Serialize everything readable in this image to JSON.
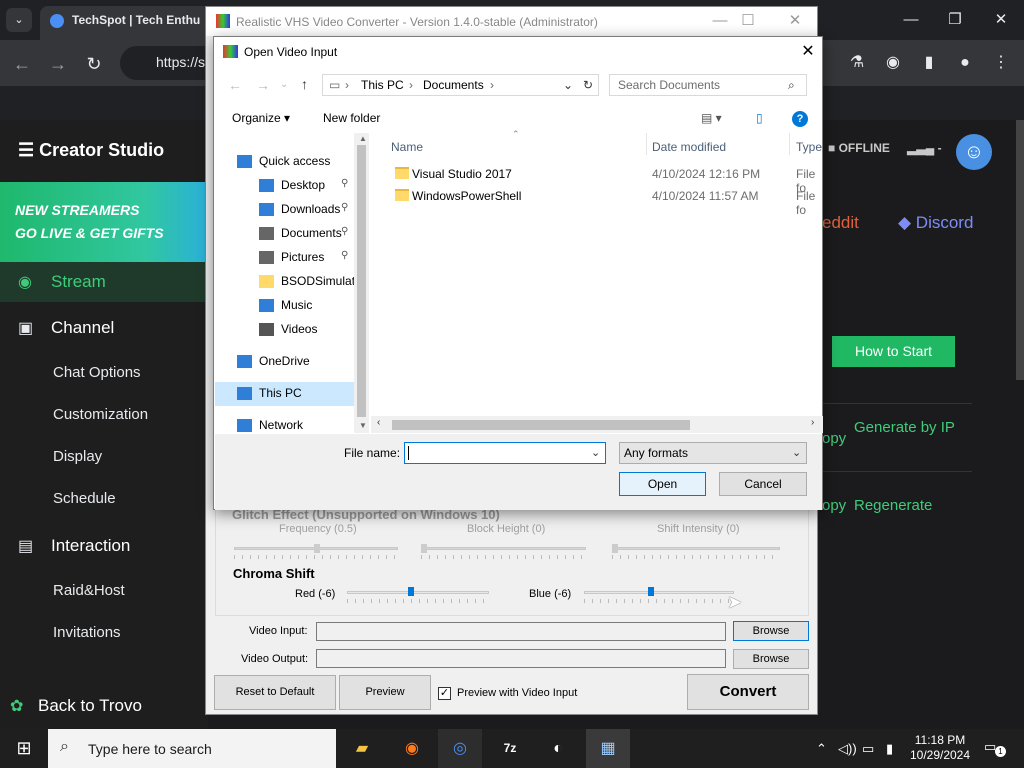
{
  "browser": {
    "tab_title": "TechSpot | Tech Enthu",
    "url": "https://s",
    "window_controls": [
      "—",
      "❐",
      "✕"
    ]
  },
  "studio": {
    "title": "Creator Studio",
    "banner_line1": "NEW STREAMERS",
    "banner_line2": "GO LIVE & GET GIFTS",
    "sidebar": {
      "stream": "Stream",
      "channel": "Channel",
      "chat_options": "Chat Options",
      "customization": "Customization",
      "display": "Display",
      "schedule": "Schedule",
      "interaction": "Interaction",
      "raid_host": "Raid&Host",
      "invitations": "Invitations",
      "back": "Back to Trovo"
    },
    "status": "OFFLINE",
    "status_dash": "-",
    "reddit": "eddit",
    "discord": "Discord",
    "how_to_start": "How to Start",
    "copy1": "opy",
    "generate_by_ip": "Generate by IP",
    "copy2": "opy",
    "regenerate": "Regenerate"
  },
  "vhs": {
    "title": "Realistic VHS Video Converter - Version 1.4.0-stable (Administrator)",
    "glitch_heading": "Glitch Effect (Unsupported on Windows 10)",
    "frequency": "Frequency (0.5)",
    "block_height": "Block Height (0)",
    "shift_intensity": "Shift Intensity (0)",
    "chroma_heading": "Chroma Shift",
    "red": "Red (-6)",
    "blue": "Blue (-6)",
    "video_input_label": "Video Input:",
    "video_output_label": "Video Output:",
    "browse": "Browse",
    "reset": "Reset to Default",
    "preview": "Preview",
    "preview_with_input": "Preview with Video Input",
    "preview_with_input_checked": true,
    "convert": "Convert"
  },
  "dialog": {
    "title": "Open Video Input",
    "breadcrumb": [
      "This PC",
      "Documents"
    ],
    "search_placeholder": "Search Documents",
    "organize": "Organize",
    "new_folder": "New folder",
    "nav": [
      {
        "label": "Quick access",
        "icon": "star-icon",
        "pinned": false
      },
      {
        "label": "Desktop",
        "icon": "desktop-icon",
        "pinned": true
      },
      {
        "label": "Downloads",
        "icon": "download-icon",
        "pinned": true
      },
      {
        "label": "Documents",
        "icon": "documents-icon",
        "pinned": true
      },
      {
        "label": "Pictures",
        "icon": "pictures-icon",
        "pinned": true
      },
      {
        "label": "BSODSimulator_",
        "icon": "folder-icon",
        "pinned": false
      },
      {
        "label": "Music",
        "icon": "music-icon",
        "pinned": false
      },
      {
        "label": "Videos",
        "icon": "videos-icon",
        "pinned": false
      },
      {
        "label": "OneDrive",
        "icon": "cloud-icon",
        "pinned": false
      },
      {
        "label": "This PC",
        "icon": "computer-icon",
        "pinned": false
      },
      {
        "label": "Network",
        "icon": "network-icon",
        "pinned": false
      }
    ],
    "columns": {
      "name": "Name",
      "date": "Date modified",
      "type": "Type"
    },
    "files": [
      {
        "name": "Visual Studio 2017",
        "date": "4/10/2024 12:16 PM",
        "type": "File fo"
      },
      {
        "name": "WindowsPowerShell",
        "date": "4/10/2024 11:57 AM",
        "type": "File fo"
      }
    ],
    "file_name_label": "File name:",
    "file_name_value": "",
    "file_type": "Any formats",
    "open": "Open",
    "cancel": "Cancel"
  },
  "taskbar": {
    "search_placeholder": "Type here to search",
    "time": "11:18 PM",
    "date": "10/29/2024",
    "notification_count": "1"
  }
}
